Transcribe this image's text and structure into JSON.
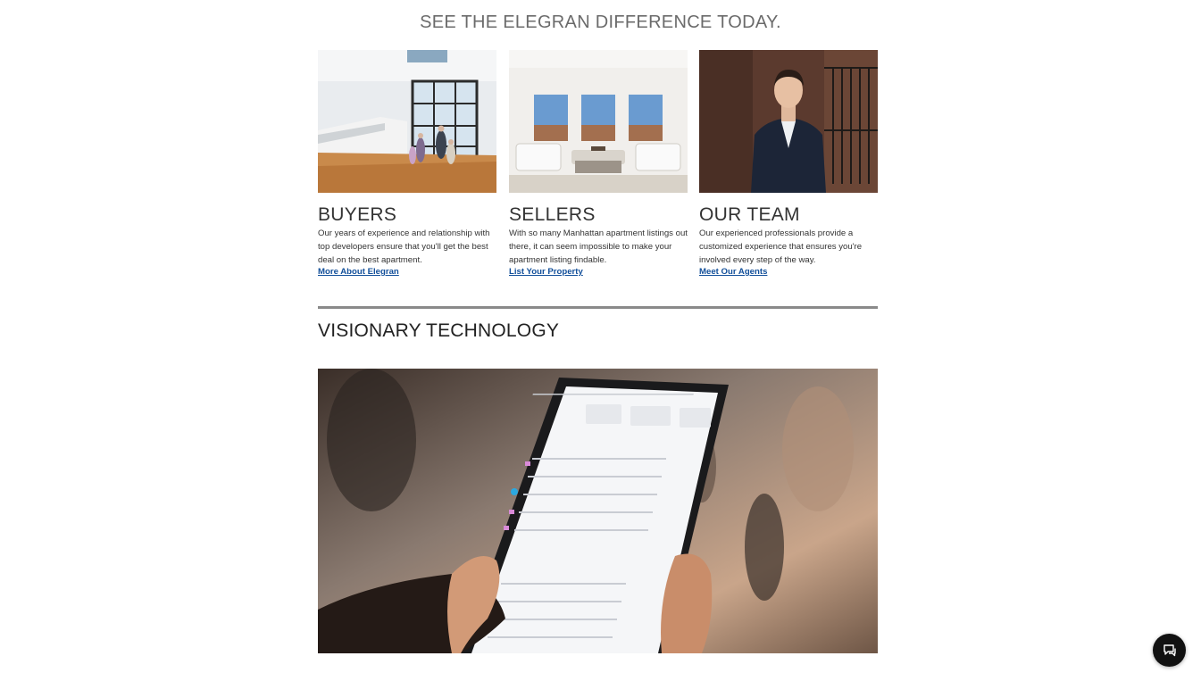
{
  "page": {
    "headline": "SEE THE ELEGRAN DIFFERENCE TODAY."
  },
  "cards": [
    {
      "title": "BUYERS",
      "body": "Our years of experience and relationship with top developers ensure that you'll get the best deal on the best apartment.",
      "link": "More About Elegran",
      "image": "family-in-loft-photo"
    },
    {
      "title": "SELLERS",
      "body": "With so many Manhattan apartment listings out there, it can seem impossible to make your apartment listing findable.",
      "link": "List Your Property",
      "image": "living-room-photo"
    },
    {
      "title": "OUR TEAM",
      "body": "Our experienced professionals provide a customized experience that ensures you're involved every step of the way.",
      "link": "Meet Our Agents",
      "image": "agent-portrait-photo"
    }
  ],
  "technology": {
    "title": "VISIONARY TECHNOLOGY",
    "image": "tablet-dashboard-photo"
  },
  "chat": {
    "icon": "chat-icon"
  },
  "colors": {
    "headline": "#6b6b6b",
    "link": "#124f9a",
    "divider": "#8a8a8a",
    "chat_bg": "#111111"
  }
}
